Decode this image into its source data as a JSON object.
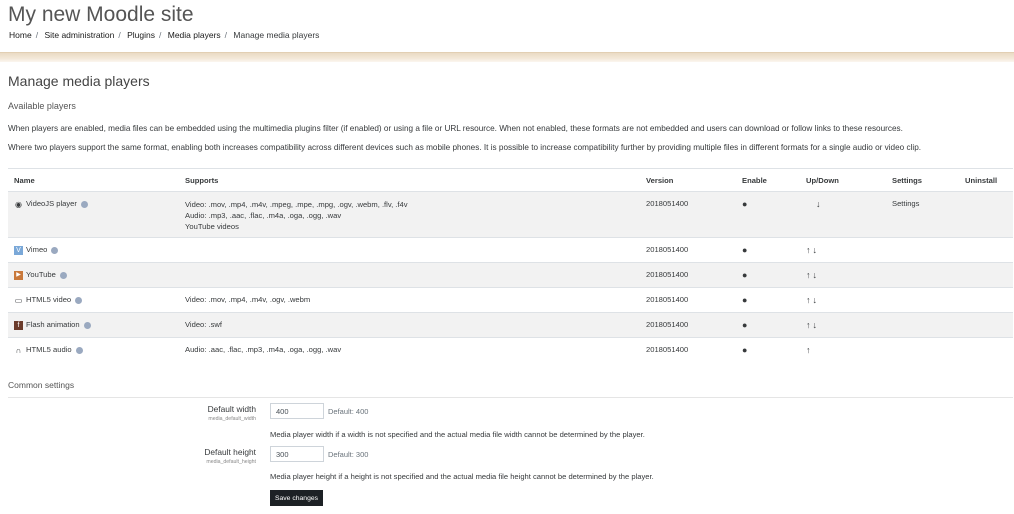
{
  "site": {
    "title": "My new Moodle site"
  },
  "breadcrumb": [
    "Home",
    "Site administration",
    "Plugins",
    "Media players",
    "Manage media players"
  ],
  "page": {
    "heading": "Manage media players",
    "section": "Available players",
    "intro1": "When players are enabled, media files can be embedded using the multimedia plugins filter (if enabled) or using a file or URL resource. When not enabled, these formats are not embedded and users can download or follow links to these resources.",
    "intro2": "Where two players support the same format, enabling both increases compatibility across different devices such as mobile phones. It is possible to increase compatibility further by providing multiple files in different formats for a single audio or video clip."
  },
  "table": {
    "headers": {
      "name": "Name",
      "supports": "Supports",
      "version": "Version",
      "enable": "Enable",
      "updown": "Up/Down",
      "settings": "Settings",
      "uninstall": "Uninstall"
    },
    "rows": [
      {
        "name": "VideoJS player",
        "icon": "videojs-icon",
        "sup1": "Video: .mov, .mp4, .m4v, .mpeg, .mpe, .mpg, .ogv, .webm, .flv, .f4v",
        "sup2": "Audio: .mp3, .aac, .flac, .m4a, .oga, .ogg, .wav",
        "sup3": "YouTube videos",
        "version": "2018051400",
        "arrows": "↓",
        "settings": "Settings"
      },
      {
        "name": "Vimeo",
        "icon": "vimeo-icon",
        "sup1": "",
        "version": "2018051400",
        "arrows": "↑↓"
      },
      {
        "name": "YouTube",
        "icon": "youtube-icon",
        "sup1": "",
        "version": "2018051400",
        "arrows": "↑↓"
      },
      {
        "name": "HTML5 video",
        "icon": "video-camera-icon",
        "sup1": "Video: .mov, .mp4, .m4v, .ogv, .webm",
        "version": "2018051400",
        "arrows": "↑↓"
      },
      {
        "name": "Flash animation",
        "icon": "flash-icon",
        "sup1": "Video: .swf",
        "version": "2018051400",
        "arrows": "↑↓"
      },
      {
        "name": "HTML5 audio",
        "icon": "headphones-icon",
        "sup1": "Audio: .aac, .flac, .mp3, .m4a, .oga, .ogg, .wav",
        "version": "2018051400",
        "arrows": "↑"
      }
    ]
  },
  "common": {
    "heading": "Common settings",
    "width_label": "Default width",
    "width_key": "media_default_width",
    "width_value": "400",
    "width_default": "Default: 400",
    "width_desc": "Media player width if a width is not specified and the actual media file width cannot be determined by the player.",
    "height_label": "Default height",
    "height_key": "media_default_height",
    "height_value": "300",
    "height_default": "Default: 300",
    "height_desc": "Media player height if a height is not specified and the actual media file height cannot be determined by the player.",
    "save_label": "Save changes"
  }
}
